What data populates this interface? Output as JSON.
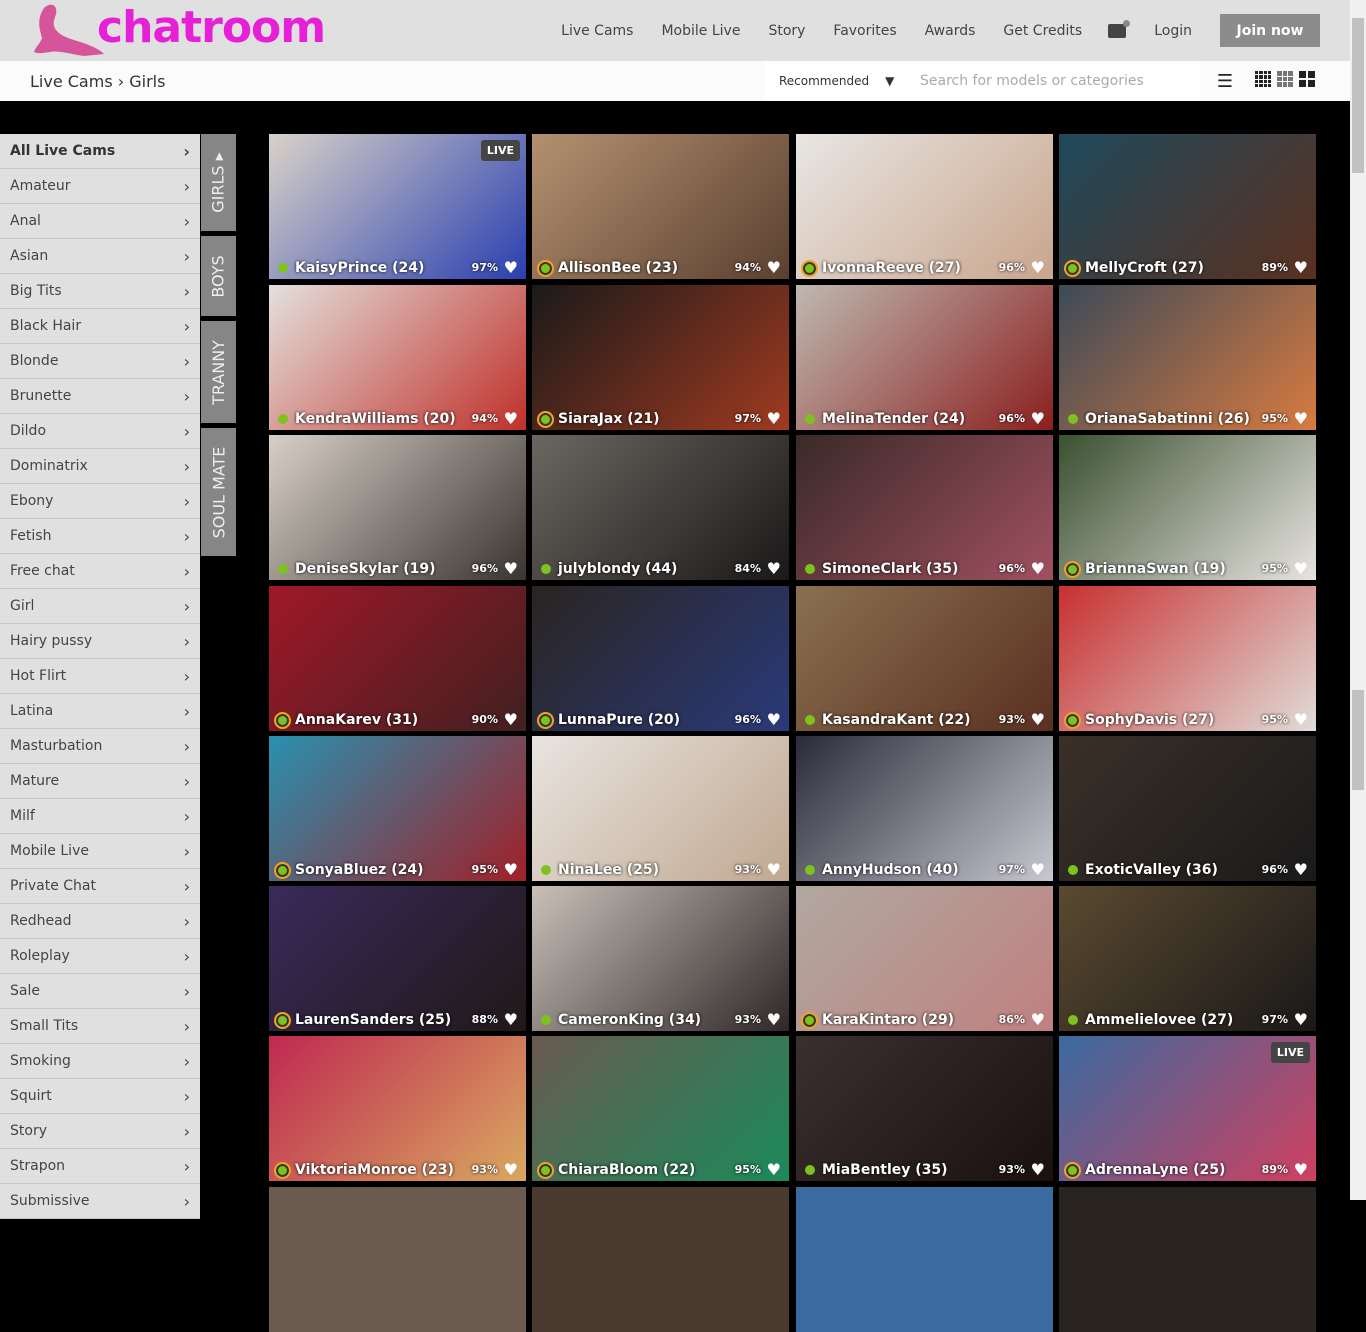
{
  "brand": {
    "name": "chatroom",
    "color": "#e620d6"
  },
  "nav": {
    "items": [
      "Live Cams",
      "Mobile Live",
      "Story",
      "Favorites",
      "Awards",
      "Get Credits"
    ],
    "login": "Login",
    "join": "Join now"
  },
  "breadcrumb": {
    "root": "Live Cams",
    "sep": "›",
    "current": "Girls"
  },
  "sort": {
    "selected": "Recommended"
  },
  "search": {
    "placeholder": "Search for models or categories"
  },
  "sidebar": {
    "items": [
      "All Live Cams",
      "Amateur",
      "Anal",
      "Asian",
      "Big Tits",
      "Black Hair",
      "Blonde",
      "Brunette",
      "Dildo",
      "Dominatrix",
      "Ebony",
      "Fetish",
      "Free chat",
      "Girl",
      "Hairy pussy",
      "Hot Flirt",
      "Latina",
      "Masturbation",
      "Mature",
      "Milf",
      "Mobile Live",
      "Private Chat",
      "Redhead",
      "Roleplay",
      "Sale",
      "Small Tits",
      "Smoking",
      "Squirt",
      "Story",
      "Strapon",
      "Submissive"
    ]
  },
  "tabs": [
    "GIRLS",
    "BOYS",
    "TRANNY",
    "SOUL MATE"
  ],
  "live_badge": "LIVE",
  "models": [
    {
      "name": "KaisyPrince (24)",
      "rating": "97%",
      "ring": false,
      "live": true,
      "c": [
        "#d9d2c8",
        "#2a3fb0"
      ]
    },
    {
      "name": "AllisonBee (23)",
      "rating": "94%",
      "ring": true,
      "c": [
        "#b49070",
        "#5a4030"
      ]
    },
    {
      "name": "IvonnaReeve (27)",
      "rating": "96%",
      "ring": true,
      "c": [
        "#e8e6e4",
        "#c9a58c"
      ]
    },
    {
      "name": "MellyCroft (27)",
      "rating": "89%",
      "ring": true,
      "c": [
        "#1f4a5c",
        "#5a3020"
      ]
    },
    {
      "name": "KendraWilliams (20)",
      "rating": "94%",
      "ring": false,
      "c": [
        "#e4e0dc",
        "#c0302a"
      ]
    },
    {
      "name": "SiaraJax (21)",
      "rating": "97%",
      "ring": true,
      "c": [
        "#1a1a1a",
        "#a03a20"
      ]
    },
    {
      "name": "MelinaTender (24)",
      "rating": "96%",
      "ring": false,
      "c": [
        "#bfb8b0",
        "#8a2020"
      ]
    },
    {
      "name": "OrianaSabatinni (26)",
      "rating": "95%",
      "ring": false,
      "c": [
        "#3c4a58",
        "#d87a40"
      ]
    },
    {
      "name": "DeniseSkylar (19)",
      "rating": "96%",
      "ring": false,
      "c": [
        "#d8d0c8",
        "#3a3430"
      ]
    },
    {
      "name": "julyblondy (44)",
      "rating": "84%",
      "ring": false,
      "c": [
        "#6a6660",
        "#1a1818"
      ]
    },
    {
      "name": "SimoneClark (35)",
      "rating": "96%",
      "ring": false,
      "c": [
        "#3a2a28",
        "#a05060"
      ]
    },
    {
      "name": "BriannaSwan (19)",
      "rating": "95%",
      "ring": true,
      "c": [
        "#3a5030",
        "#e8e4e0"
      ]
    },
    {
      "name": "AnnaKarev (31)",
      "rating": "90%",
      "ring": true,
      "c": [
        "#a01828",
        "#402020"
      ]
    },
    {
      "name": "LunnaPure (20)",
      "rating": "96%",
      "ring": true,
      "c": [
        "#2a2420",
        "#2a3a7a"
      ]
    },
    {
      "name": "KasandraKant (22)",
      "rating": "93%",
      "ring": false,
      "c": [
        "#8a7050",
        "#5a3020"
      ]
    },
    {
      "name": "SophyDavis (27)",
      "rating": "95%",
      "ring": true,
      "c": [
        "#c83030",
        "#e0dcd8"
      ]
    },
    {
      "name": "SonyaBluez (24)",
      "rating": "95%",
      "ring": true,
      "c": [
        "#2a90b0",
        "#a02028"
      ]
    },
    {
      "name": "NinaLee (25)",
      "rating": "93%",
      "ring": false,
      "c": [
        "#e8e4e0",
        "#c0a890"
      ]
    },
    {
      "name": "AnnyHudson (40)",
      "rating": "97%",
      "ring": false,
      "c": [
        "#2a2a3a",
        "#c8c8d0"
      ]
    },
    {
      "name": "ExoticValley (36)",
      "rating": "96%",
      "ring": false,
      "c": [
        "#3a3028",
        "#1a1a1a"
      ]
    },
    {
      "name": "LaurenSanders (25)",
      "rating": "88%",
      "ring": true,
      "c": [
        "#3a2a5a",
        "#201818"
      ]
    },
    {
      "name": "CameronKing (34)",
      "rating": "93%",
      "ring": false,
      "c": [
        "#c8c0b8",
        "#302828"
      ]
    },
    {
      "name": "KaraKintaro (29)",
      "rating": "86%",
      "ring": true,
      "c": [
        "#b0a8a0",
        "#c08080"
      ]
    },
    {
      "name": "Ammelielovee (27)",
      "rating": "97%",
      "ring": false,
      "c": [
        "#5a4a30",
        "#1a1818"
      ]
    },
    {
      "name": "ViktoriaMonroe (23)",
      "rating": "93%",
      "ring": true,
      "c": [
        "#c02850",
        "#d8a860"
      ]
    },
    {
      "name": "ChiaraBloom (22)",
      "rating": "95%",
      "ring": true,
      "c": [
        "#6a5a50",
        "#1a8a5a"
      ]
    },
    {
      "name": "MiaBentley (35)",
      "rating": "93%",
      "ring": false,
      "c": [
        "#3a3030",
        "#1a1010"
      ]
    },
    {
      "name": "AdrennaLyne (25)",
      "rating": "89%",
      "ring": true,
      "live": true,
      "c": [
        "#3a6aa0",
        "#d04060"
      ]
    }
  ]
}
